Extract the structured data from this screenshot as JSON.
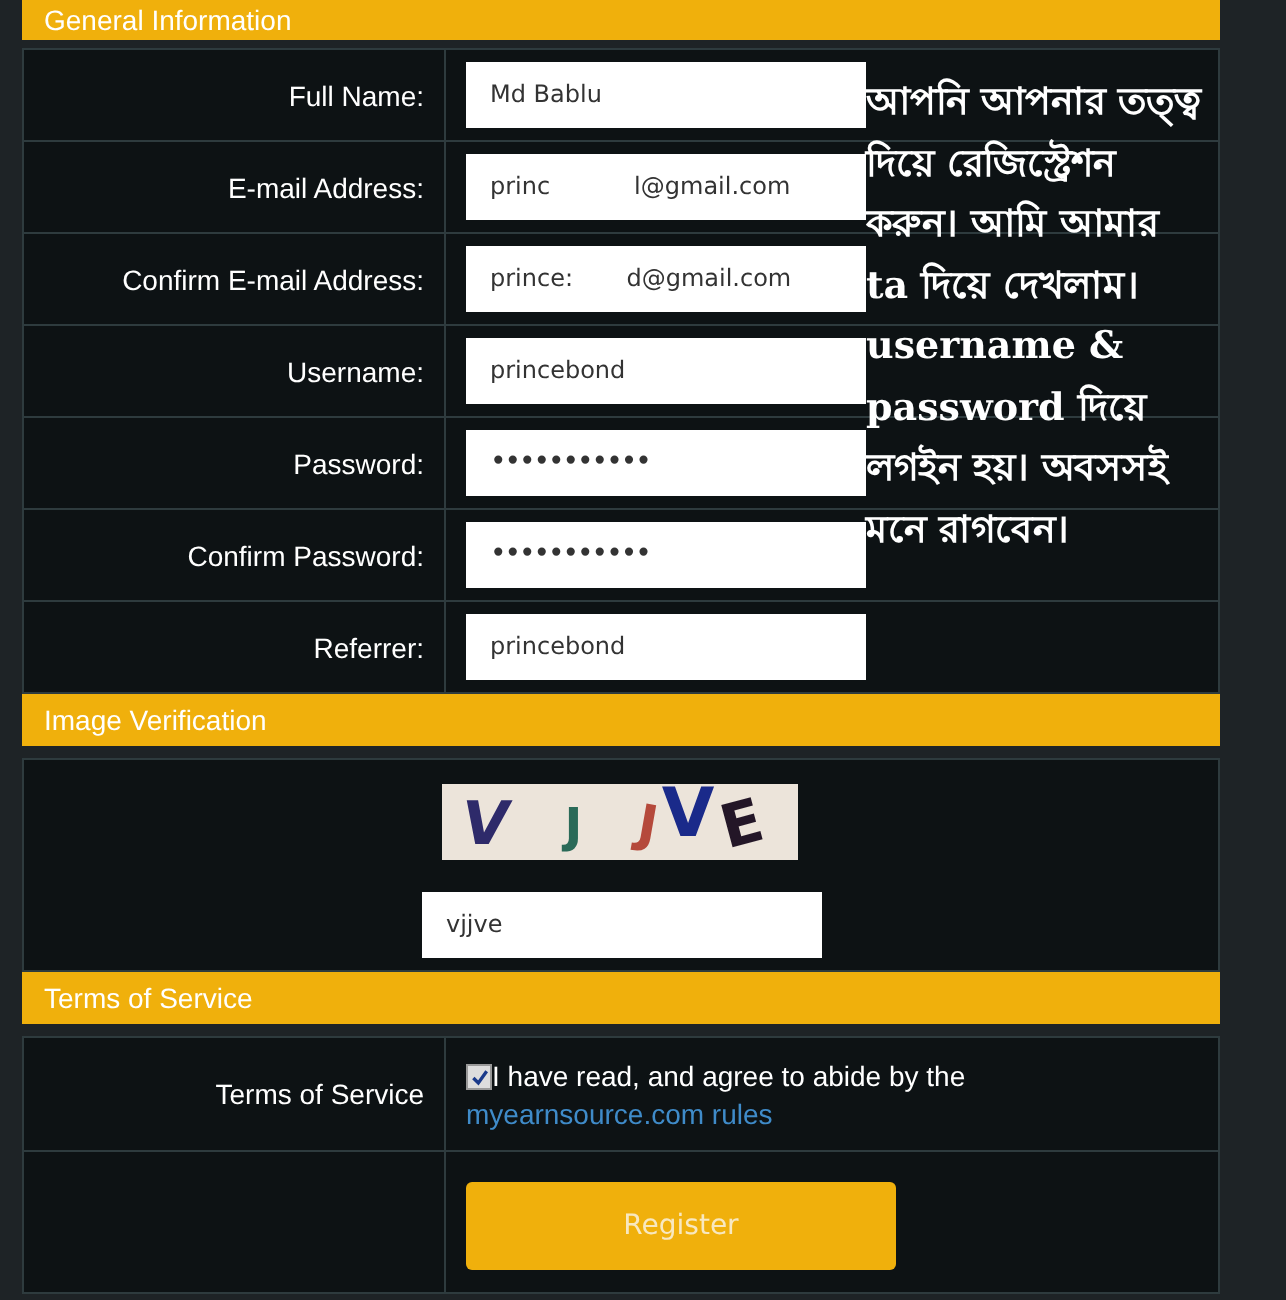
{
  "sections": [
    {
      "kind": "fields",
      "title": "General Information",
      "fields": [
        {
          "label": "Full Name:",
          "value": "Md Bablu",
          "kind": "text"
        },
        {
          "label": "E-mail Address:",
          "value": "princ           l@gmail.com",
          "kind": "text"
        },
        {
          "label": "Confirm E-mail Address:",
          "value": "prince:       d@gmail.com",
          "kind": "text"
        },
        {
          "label": "Username:",
          "value": "princebond",
          "kind": "text"
        },
        {
          "label": "Password:",
          "value": "•••••••••••",
          "kind": "password"
        },
        {
          "label": "Confirm Password:",
          "value": "•••••••••••",
          "kind": "password"
        },
        {
          "label": "Referrer:",
          "value": "princebond",
          "kind": "text"
        }
      ]
    },
    {
      "kind": "captcha",
      "title": "Image Verification",
      "letters": [
        {
          "char": "V",
          "color": "#2e2a6a"
        },
        {
          "char": "J",
          "color": "#2a6a58"
        },
        {
          "char": "J",
          "color": "#b5493b"
        },
        {
          "char": "V",
          "color": "#1a2a8a"
        },
        {
          "char": "E",
          "color": "#231627"
        }
      ],
      "value": "vjjve"
    },
    {
      "kind": "terms",
      "title": "Terms of Service",
      "label": "Terms of Service",
      "agreed": true,
      "text": "I have read, and agree to abide by the",
      "link": "myearnsource.com rules",
      "button": "Register"
    }
  ],
  "note": "আপনি আপনার তত্ত্ব দিয়ে রেজিস্ট্রেশন করুন। আমি আমার ta দিয়ে দেখলাম। username & password  দিয়ে লগইন হয়। অবসসই মনে রাগবেন।"
}
